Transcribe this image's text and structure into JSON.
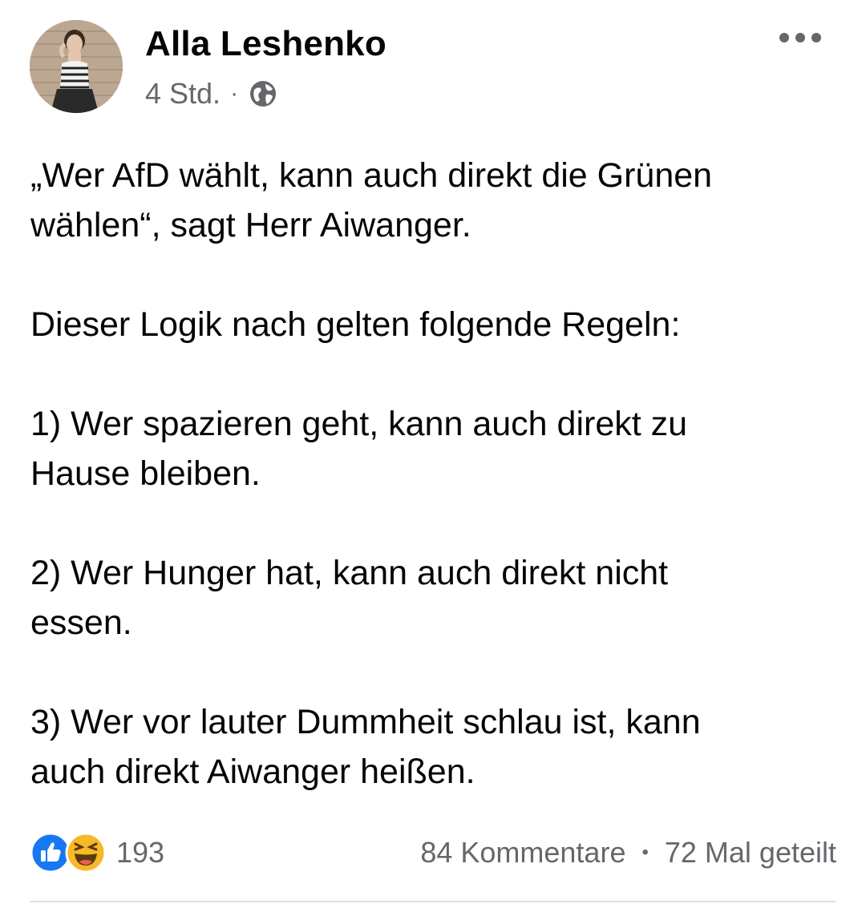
{
  "post": {
    "author": "Alla Leshenko",
    "time": "4 Std.",
    "separator": "·",
    "privacy_icon": "globe-icon",
    "menu_icon": "more-options-icon",
    "paragraphs": [
      [
        "„Wer AfD wählt, kann auch direkt die Grünen",
        "wählen“, sagt Herr Aiwanger."
      ],
      [
        "Dieser Logik nach gelten folgende Regeln:"
      ],
      [
        "1) Wer spazieren geht, kann auch direkt zu",
        "Hause bleiben."
      ],
      [
        "2) Wer Hunger hat, kann auch direkt nicht",
        "essen."
      ],
      [
        "3) Wer vor lauter Dummheit schlau ist, kann",
        "auch direkt Aiwanger heißen."
      ]
    ]
  },
  "stats": {
    "reaction_icons": [
      "like-icon",
      "haha-icon"
    ],
    "reaction_count": "193",
    "comments": "84 Kommentare",
    "bullet": "•",
    "shares": "72 Mal geteilt"
  },
  "colors": {
    "text": "#050505",
    "secondary": "#65676b",
    "like_blue": "#1877f2",
    "haha_yellow": "#f7b928",
    "divider": "#dddfe2"
  }
}
